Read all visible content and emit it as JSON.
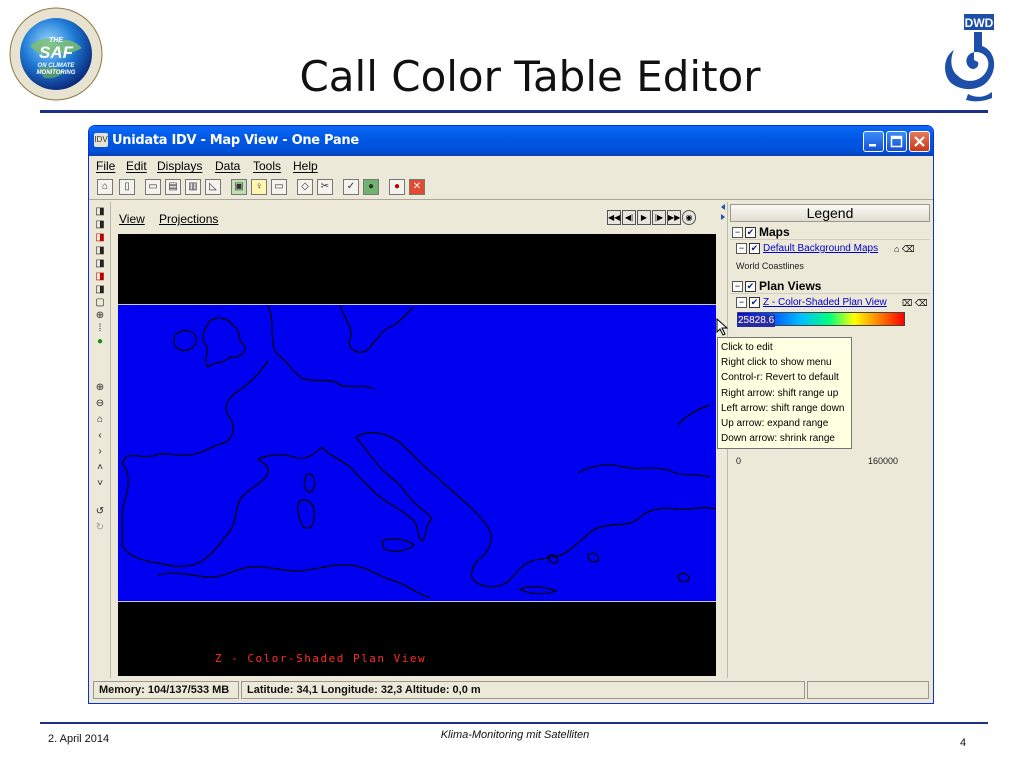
{
  "slide": {
    "title": "Call Color Table Editor",
    "footer_date": "2. April 2014",
    "footer_center": "Klima-Monitoring mit Satelliten",
    "page_number": "4"
  },
  "logos": {
    "saf_line1": "THE",
    "saf_line2": "SAF",
    "saf_line3": "ON CLIMATE",
    "saf_line4": "MONITORING",
    "dwd": "DWD"
  },
  "window": {
    "title": "Unidata IDV - Map View - One Pane",
    "icon_text": "IDV"
  },
  "menubar": {
    "items": [
      "File",
      "Edit",
      "Displays",
      "Data",
      "Tools",
      "Help"
    ]
  },
  "view_tabs": {
    "view": "View",
    "projections": "Projections"
  },
  "map": {
    "display_label": "Z - Color-Shaded Plan View"
  },
  "legend": {
    "header": "Legend",
    "maps_section": "Maps",
    "default_maps_link": "Default Background Maps",
    "world_coastlines": "World Coastlines",
    "plan_views_section": "Plan Views",
    "plan_view_link": "Z - Color-Shaded Plan View",
    "bar_value": "25828.6",
    "range_min": "0",
    "range_max": "160000"
  },
  "tooltip": {
    "lines": [
      "Click to edit",
      "Right click to show menu",
      "Control-r: Revert to default",
      "Right arrow: shift range up",
      "Left arrow: shift range down",
      "Up arrow: expand range",
      "Down arrow: shrink range"
    ]
  },
  "statusbar": {
    "memory": "Memory: 104/137/533 MB",
    "location": "Latitude:   34,1 Longitude:   32,3 Altitude:    0,0 m"
  },
  "colors": {
    "title_bar": "#0058e6",
    "map_background": "#0000f0",
    "map_label": "#ff2a2a",
    "slide_rule": "#1c2f8a"
  }
}
